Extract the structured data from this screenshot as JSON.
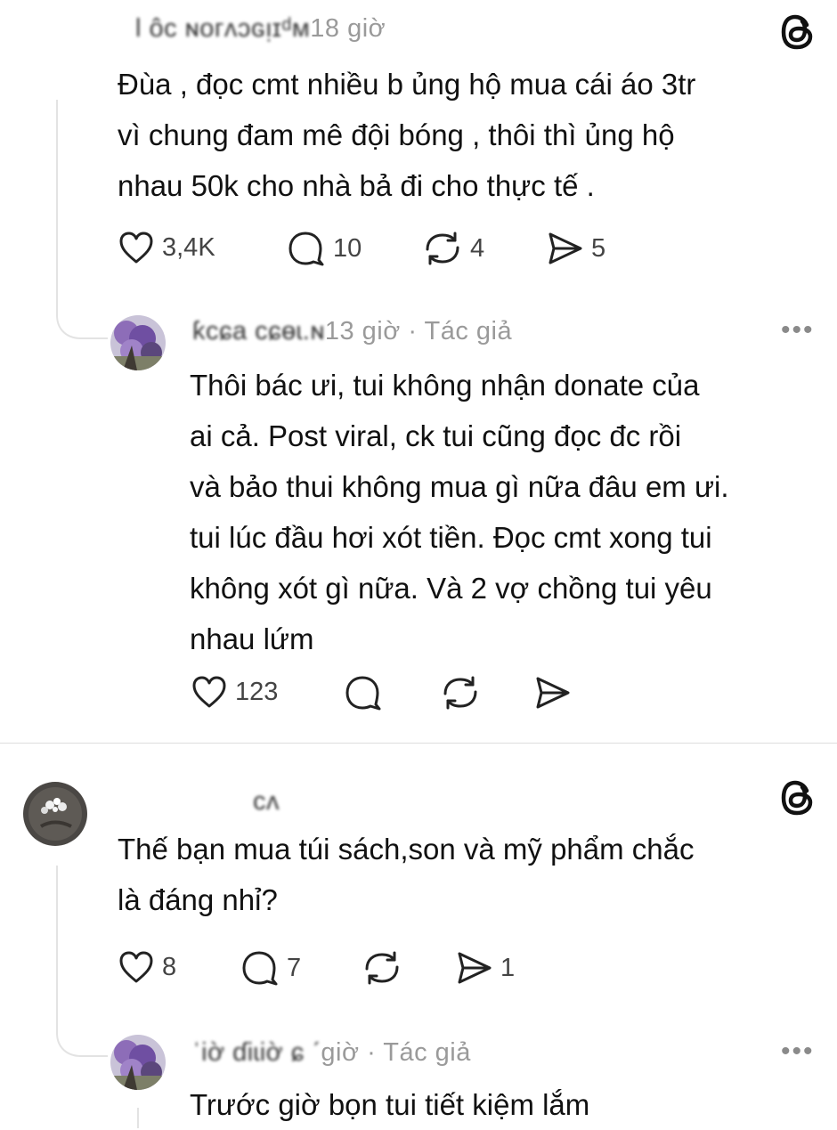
{
  "app": {
    "accent": "#111111",
    "icon_name": "threads-logo-icon"
  },
  "threads": [
    {
      "post": {
        "username_obscured": "l ôc ɴoᴦᴧɔɢᴉɪᵈᴍ",
        "time": "18 giờ",
        "text": "Đùa , đọc cmt nhiều b ủng hộ mua cái áo 3tr\nvì chung đam mê đội bóng , thôi thì ủng hộ\nnhau 50k cho nhà bả đi cho thực tế .",
        "likes": "3,4K",
        "replies": "10",
        "reposts": "4",
        "shares": "5"
      },
      "reply": {
        "username_obscured": "ƙcɕa cɕɵɩ.ɴ",
        "time": "13 giờ",
        "author_tag": "· Tác giả",
        "more": "•••",
        "text": "Thôi bác ưi, tui không nhận donate của\nai cả. Post viral, ck tui cũng đọc đc  rồi\nvà bảo thui không mua gì nữa đâu em ưi.\ntui lúc đầu hơi xót tiền. Đọc cmt xong tui\nkhông xót gì nữa. Và 2 vợ chồng tui yêu\nnhau lứm",
        "likes": "123"
      }
    },
    {
      "post": {
        "username_obscured": "ᴄᴧ",
        "text": "Thế bạn mua túi sách,son và mỹ phẩm chắc\nlà đáng nhỉ?",
        "likes": "8",
        "replies": "7",
        "shares": "1"
      },
      "reply": {
        "username_obscured": "ˈiờ ɗiɩiờ ɕ ˊ",
        "time": "giờ",
        "author_tag": "· Tác giả",
        "more": "•••",
        "text": "Trước giờ bọn tui tiết kiệm lắm"
      }
    }
  ]
}
